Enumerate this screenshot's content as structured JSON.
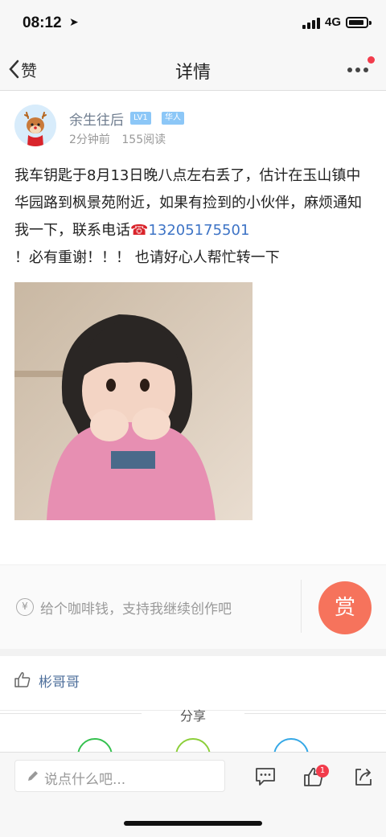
{
  "status_bar": {
    "time": "08:12",
    "network": "4G"
  },
  "nav": {
    "back_label": "赞",
    "title": "详情"
  },
  "post": {
    "author": "余生往后",
    "level_badge": "LV1",
    "tag_badge": "华人",
    "time_ago": "2分钟前",
    "views": "155阅读",
    "text_line1": "我车钥匙于8月13日晚八点左右丢了，估计在玉山镇中华园路到枫景苑附近，如果有捡到的小伙伴，麻烦通知我一下，联系电话",
    "phone_icon": "☎",
    "phone": "13205175501",
    "text_line2": "！必有重谢！！！ 也请好心人帮忙转一下"
  },
  "reward": {
    "currency_icon": "¥",
    "prompt": "给个咖啡钱，支持我继续创作吧",
    "button": "赏"
  },
  "likes": {
    "liker": "彬哥哥"
  },
  "share": {
    "title": "分享"
  },
  "bottom": {
    "placeholder": "说点什么吧...",
    "like_count": "1"
  },
  "colors": {
    "accent": "#f6735c",
    "link": "#3e74c6",
    "badge_red": "#f23c4c"
  }
}
